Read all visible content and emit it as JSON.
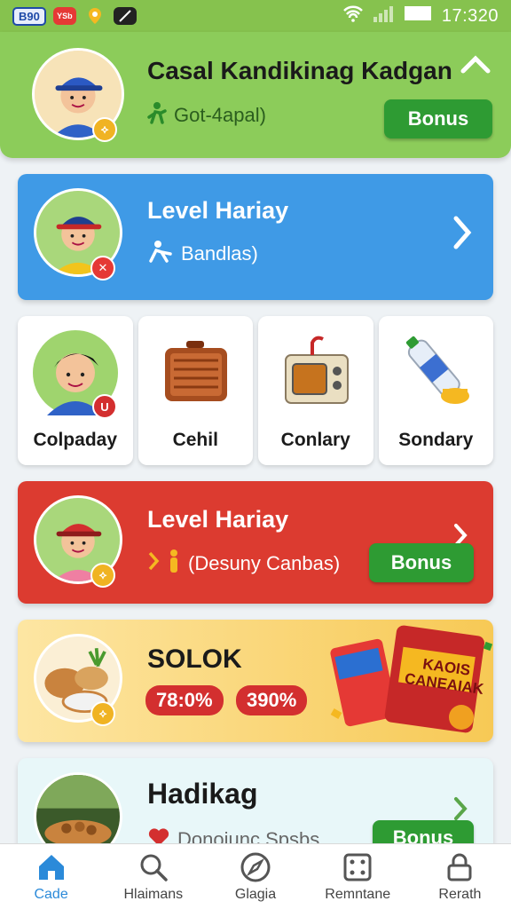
{
  "status_bar": {
    "badge": "B90",
    "app1": "YSb",
    "time": "17:320"
  },
  "top_card": {
    "title": "Casal Kandikinag Kadgan",
    "subtitle": "Got-4apal)",
    "bonus_label": "Bonus",
    "avatar_badge": "⟡",
    "color": "#8ccc5a"
  },
  "level_card_blue": {
    "title": "Level Hariay",
    "subtitle": "Bandlas)",
    "color": "#3f9ae6"
  },
  "tiles": [
    {
      "label": "Colpaday",
      "badge": "U"
    },
    {
      "label": "Cehil"
    },
    {
      "label": "Conlary"
    },
    {
      "label": "Sondary"
    }
  ],
  "level_card_red": {
    "title": "Level Hariay",
    "subtitle": "(Desuny Canbas)",
    "bonus_label": "Bonus",
    "color": "#dc3b30"
  },
  "solok_card": {
    "title": "SOLOK",
    "pill1": "78:0%",
    "pill2": "390%",
    "promo_text": "KAOIS CANEAIAK"
  },
  "hadikag_card": {
    "title": "Hadikag",
    "subtitle": "Donoiunc Spsbs",
    "bonus_label": "Bonus"
  },
  "nav": [
    {
      "label": "Cade",
      "icon": "home-icon",
      "active": true
    },
    {
      "label": "Hlaimans",
      "icon": "search-icon"
    },
    {
      "label": "Glagia",
      "icon": "compass-icon"
    },
    {
      "label": "Remntane",
      "icon": "grid-icon"
    },
    {
      "label": "Rerath",
      "icon": "lock-icon"
    }
  ]
}
